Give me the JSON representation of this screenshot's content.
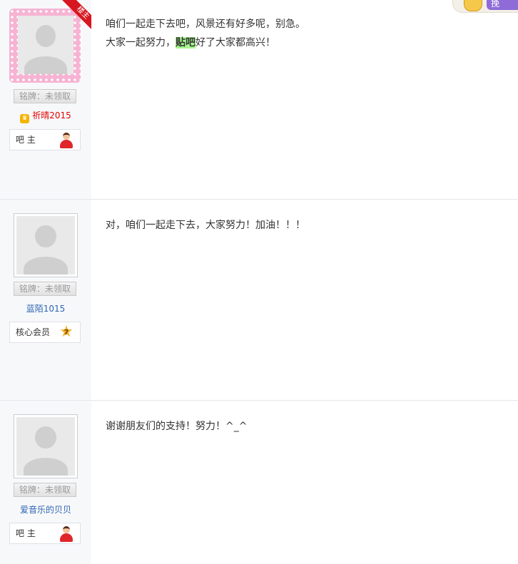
{
  "topbar": {
    "button_label": "挽"
  },
  "posts": [
    {
      "ribbon": "楼主",
      "medal": "铭牌：未领取",
      "username": "祈晴2015",
      "rank_label": "吧 主",
      "content": {
        "line1": "咱们一起走下去吧，风景还有好多呢，别急。",
        "line2_pre": "大家一起努力，",
        "line2_hl": "贴吧",
        "line2_post": "好了大家都高兴！"
      }
    },
    {
      "medal": "铭牌：未领取",
      "username": "蓝陌1015",
      "rank_label": "核心会员",
      "rank_level": "7",
      "content": {
        "line1": "对，咱们一起走下去，大家努力！加油！！！"
      }
    },
    {
      "medal": "铭牌：未领取",
      "username": "爱音乐的贝贝",
      "rank_label": "吧 主",
      "content": {
        "line1": "谢谢朋友们的支持！努力！^_^"
      }
    }
  ]
}
